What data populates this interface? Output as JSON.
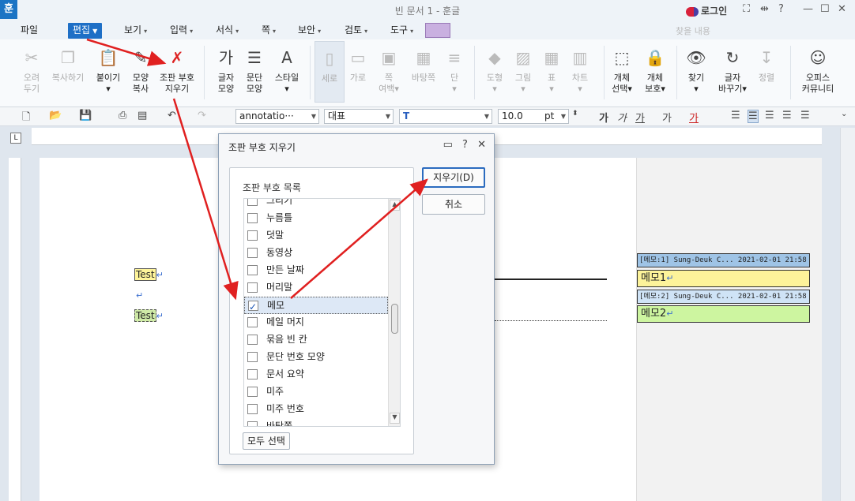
{
  "app": {
    "logo": "훈",
    "title": "빈 문서 1 - 훈글",
    "login": "로그인",
    "search_hint": "찾을 내용"
  },
  "menu": [
    {
      "label": "파일",
      "has_arrow": false
    },
    {
      "label": "편집",
      "has_arrow": true,
      "active": true
    },
    {
      "label": "보기",
      "has_arrow": true
    },
    {
      "label": "입력",
      "has_arrow": true
    },
    {
      "label": "서식",
      "has_arrow": true
    },
    {
      "label": "쪽",
      "has_arrow": true
    },
    {
      "label": "보안",
      "has_arrow": true
    },
    {
      "label": "검토",
      "has_arrow": true
    },
    {
      "label": "도구",
      "has_arrow": true
    }
  ],
  "ribbon": [
    {
      "line1": "오려",
      "line2": "두기",
      "icon": "scissors-icon",
      "glyph": "✂",
      "dim": true
    },
    {
      "line1": "복사하기",
      "line2": "",
      "icon": "copy-icon",
      "glyph": "❐",
      "dim": true
    },
    {
      "line1": "붙이기",
      "line2": "▾",
      "icon": "paste-icon",
      "glyph": "📋",
      "dim": false
    },
    {
      "line1": "모양",
      "line2": "복사",
      "icon": "format-painter-icon",
      "glyph": "✎",
      "dim": false
    },
    {
      "line1": "조판 부호",
      "line2": "지우기",
      "icon": "clear-marks-icon",
      "glyph": "✗",
      "dim": false
    },
    {
      "line1": "글자",
      "line2": "모양",
      "icon": "char-shape-icon",
      "glyph": "가",
      "dim": false
    },
    {
      "line1": "문단",
      "line2": "모양",
      "icon": "para-shape-icon",
      "glyph": "☰",
      "dim": false
    },
    {
      "line1": "스타일",
      "line2": "▾",
      "icon": "style-icon",
      "glyph": "A",
      "dim": false
    },
    {
      "line1": "세로",
      "line2": "",
      "icon": "vertical-icon",
      "glyph": "▯",
      "dim": true
    },
    {
      "line1": "가로",
      "line2": "",
      "icon": "horizontal-icon",
      "glyph": "▭",
      "dim": true
    },
    {
      "line1": "쪽",
      "line2": "여백▾",
      "icon": "margin-icon",
      "glyph": "▣",
      "dim": true
    },
    {
      "line1": "바탕쪽",
      "line2": "",
      "icon": "master-page-icon",
      "glyph": "▦",
      "dim": true
    },
    {
      "line1": "단",
      "line2": "▾",
      "icon": "columns-icon",
      "glyph": "≡",
      "dim": true
    },
    {
      "line1": "도형",
      "line2": "▾",
      "icon": "shape-icon",
      "glyph": "◆",
      "dim": true
    },
    {
      "line1": "그림",
      "line2": "▾",
      "icon": "picture-icon",
      "glyph": "▨",
      "dim": true
    },
    {
      "line1": "표",
      "line2": "▾",
      "icon": "table-icon",
      "glyph": "▦",
      "dim": true
    },
    {
      "line1": "차트",
      "line2": "▾",
      "icon": "chart-icon",
      "glyph": "▥",
      "dim": true
    },
    {
      "line1": "개체",
      "line2": "선택▾",
      "icon": "select-object-icon",
      "glyph": "⬚",
      "dim": false
    },
    {
      "line1": "개체",
      "line2": "보호▾",
      "icon": "protect-object-icon",
      "glyph": "🔒",
      "dim": false
    },
    {
      "line1": "찾기",
      "line2": "▾",
      "icon": "binoculars-icon",
      "glyph": "👁",
      "dim": false
    },
    {
      "line1": "글자",
      "line2": "바꾸기▾",
      "icon": "replace-icon",
      "glyph": "↻",
      "dim": false
    },
    {
      "line1": "정렬",
      "line2": "",
      "icon": "sort-icon",
      "glyph": "↧",
      "dim": true
    },
    {
      "line1": "오피스",
      "line2": "커뮤니티",
      "icon": "community-icon",
      "glyph": "☺",
      "dim": false
    }
  ],
  "format_bar": {
    "style": "annotatio···",
    "font_lang": "대표",
    "font_name": "T",
    "font_size": "10.0",
    "font_unit": "pt"
  },
  "document": {
    "line1": "Test",
    "line3": "Test"
  },
  "memos": [
    {
      "header": "[메모:1] Sung-Deuk C...  2021-02-01 21:58",
      "body": "메모1",
      "bg": "#fdf39a",
      "head_bg": "#9fc4e6"
    },
    {
      "header": "[메모:2] Sung-Deuk C...  2021-02-01 21:58",
      "body": "메모2",
      "bg": "#cdf5a0",
      "head_bg": "#cfe3f6"
    }
  ],
  "dialog": {
    "title": "조판 부호 지우기",
    "group_label": "조판 부호 목록",
    "items": [
      {
        "label": "그리기",
        "checked": false
      },
      {
        "label": "누름틀",
        "checked": false
      },
      {
        "label": "덧말",
        "checked": false
      },
      {
        "label": "동영상",
        "checked": false
      },
      {
        "label": "만든 날짜",
        "checked": false
      },
      {
        "label": "머리말",
        "checked": false
      },
      {
        "label": "메모",
        "checked": true
      },
      {
        "label": "메일 머지",
        "checked": false
      },
      {
        "label": "묶음 빈 칸",
        "checked": false
      },
      {
        "label": "문단 번호 모양",
        "checked": false
      },
      {
        "label": "문서 요약",
        "checked": false
      },
      {
        "label": "미주",
        "checked": false
      },
      {
        "label": "미주 번호",
        "checked": false
      },
      {
        "label": "바탕쪽",
        "checked": false
      }
    ],
    "select_all": "모두 선택",
    "delete_btn": "지우기(D)",
    "cancel_btn": "취소"
  },
  "annotation_color": "#e02020"
}
